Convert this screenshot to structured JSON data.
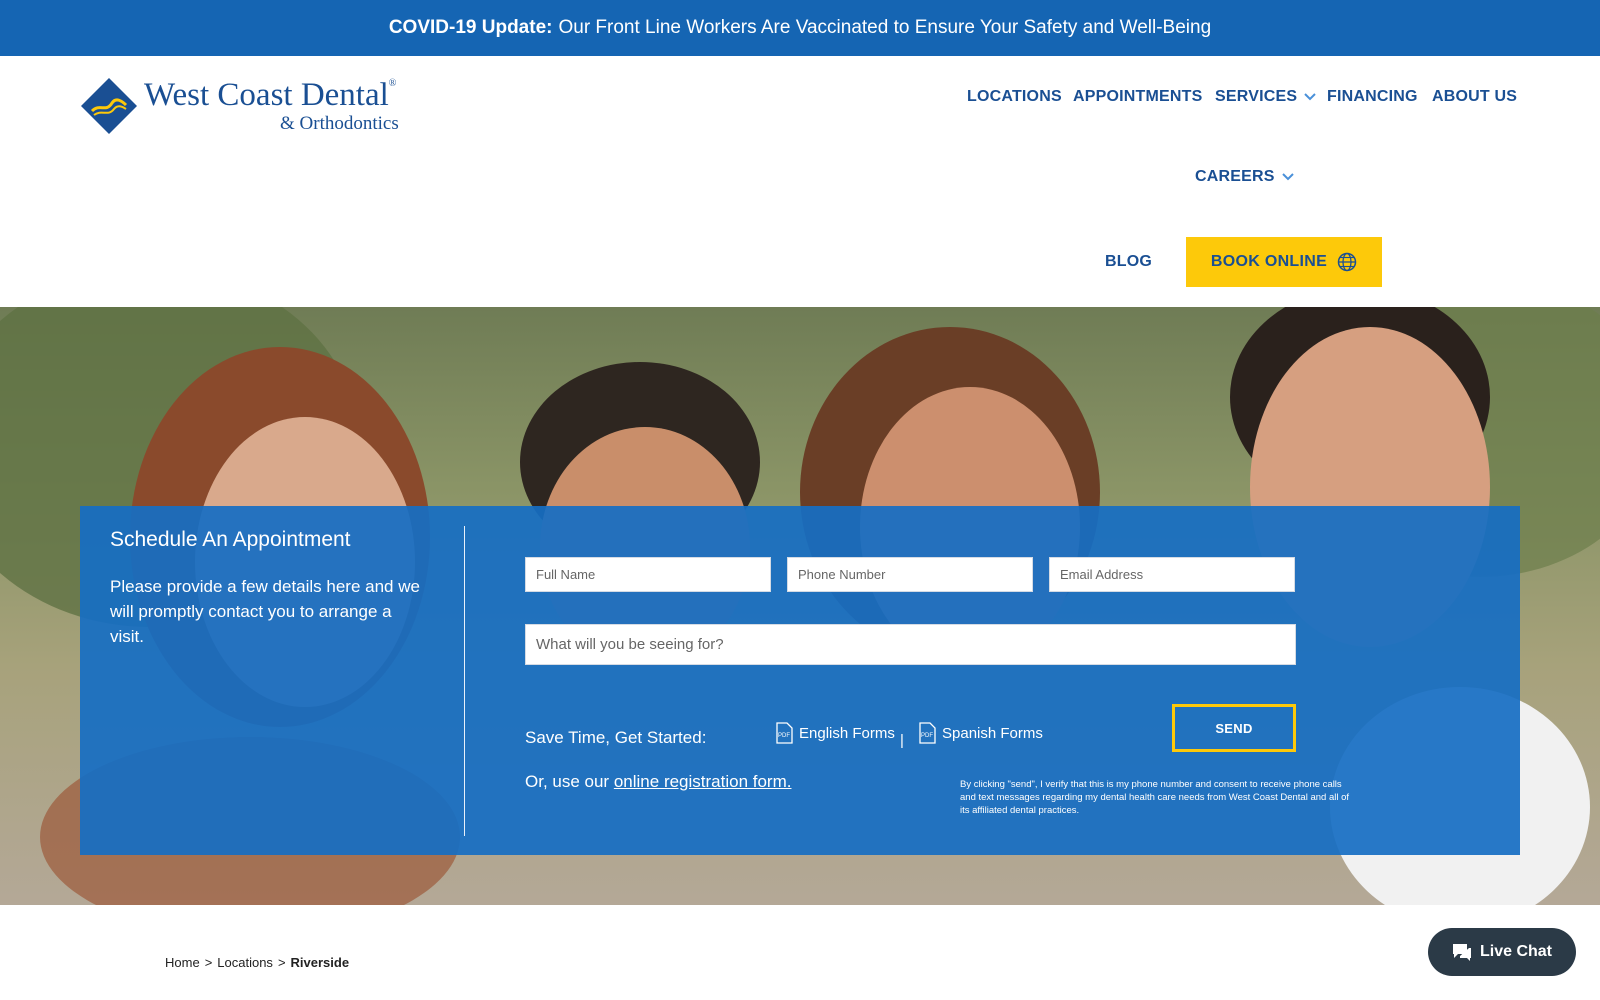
{
  "banner": {
    "bold": "COVID-19 Update:",
    "text": "Our Front Line Workers Are Vaccinated to Ensure Your Safety and Well-Being"
  },
  "logo": {
    "name": "West Coast Dental",
    "registered": "®",
    "subtitle": "& Orthodontics"
  },
  "nav": {
    "locations": "LOCATIONS",
    "appointments": "APPOINTMENTS",
    "services": "SERVICES",
    "financing": "FINANCING",
    "about": "ABOUT US",
    "careers": "CAREERS",
    "blog": "BLOG",
    "book_online": "BOOK ONLINE"
  },
  "form": {
    "title": "Schedule An Appointment",
    "description": "Please provide a few details here and we will promptly contact you to arrange a visit.",
    "full_name_placeholder": "Full Name",
    "phone_placeholder": "Phone Number",
    "email_placeholder": "Email Address",
    "seeing_placeholder": "What will you be seeing for?",
    "save_time": "Save Time, Get Started:",
    "english_forms": "English Forms",
    "separator": "|",
    "spanish_forms": "Spanish Forms",
    "registration_prefix": "Or, use our",
    "registration_link": "online registration form.",
    "send": "SEND",
    "disclaimer": "By clicking \"send\", I verify that this is my phone number and consent to receive phone calls and text messages regarding my dental health care needs from West Coast Dental and all of its affiliated dental practices."
  },
  "breadcrumb": {
    "home": "Home",
    "sep": ">",
    "locations": "Locations",
    "current": "Riverside"
  },
  "chat": {
    "label": "Live Chat"
  },
  "colors": {
    "brand_blue": "#1565b3",
    "nav_blue": "#1a4f93",
    "accent_yellow": "#fdc90a",
    "chat_dark": "#2b3a47"
  }
}
